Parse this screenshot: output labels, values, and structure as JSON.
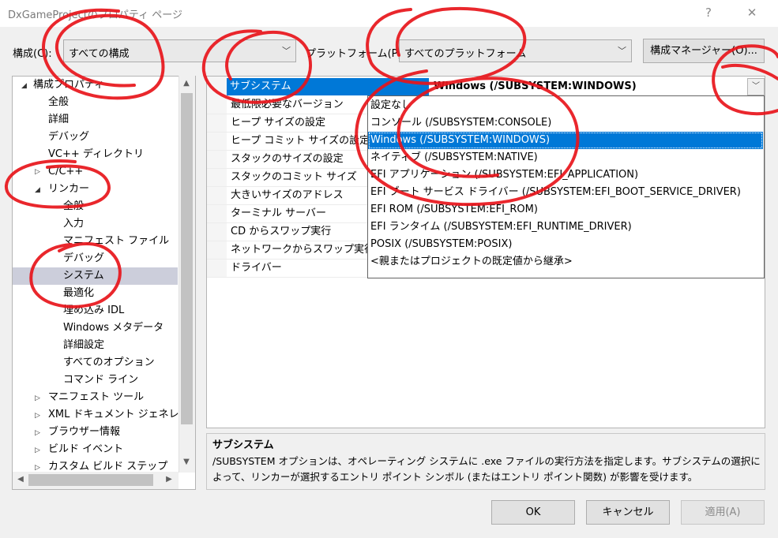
{
  "window": {
    "title": "DxGameProjectのプロパティ ページ",
    "help_glyph": "?",
    "close_glyph": "✕"
  },
  "toolbar": {
    "config_label": "構成(C):",
    "config_value": "すべての構成",
    "platform_label": "プラットフォーム(P):",
    "platform_value": "すべてのプラットフォーム",
    "config_manager_label": "構成マネージャー(O)..."
  },
  "tree": {
    "items": [
      {
        "label": "構成プロパティ",
        "expander": "◢"
      },
      {
        "label": "全般"
      },
      {
        "label": "詳細"
      },
      {
        "label": "デバッグ"
      },
      {
        "label": "VC++ ディレクトリ"
      },
      {
        "label": "C/C++",
        "expander": "▷"
      },
      {
        "label": "リンカー",
        "expander": "◢"
      },
      {
        "label": "全般"
      },
      {
        "label": "入力"
      },
      {
        "label": "マニフェスト ファイル"
      },
      {
        "label": "デバッグ"
      },
      {
        "label": "システム"
      },
      {
        "label": "最適化"
      },
      {
        "label": "埋め込み IDL"
      },
      {
        "label": "Windows メタデータ"
      },
      {
        "label": "詳細設定"
      },
      {
        "label": "すべてのオプション"
      },
      {
        "label": "コマンド ライン"
      },
      {
        "label": "マニフェスト ツール",
        "expander": "▷"
      },
      {
        "label": "XML ドキュメント ジェネレーター",
        "expander": "▷"
      },
      {
        "label": "ブラウザー情報",
        "expander": "▷"
      },
      {
        "label": "ビルド イベント",
        "expander": "▷"
      },
      {
        "label": "カスタム ビルド ステップ",
        "expander": "▷"
      }
    ]
  },
  "grid": {
    "rows": [
      {
        "name": "サブシステム"
      },
      {
        "name": "最低限必要なバージョン"
      },
      {
        "name": "ヒープ サイズの設定"
      },
      {
        "name": "ヒープ コミット サイズの設定"
      },
      {
        "name": "スタックのサイズの設定"
      },
      {
        "name": "スタックのコミット サイズ"
      },
      {
        "name": "大きいサイズのアドレス"
      },
      {
        "name": "ターミナル サーバー"
      },
      {
        "name": "CD からスワップ実行"
      },
      {
        "name": "ネットワークからスワップ実行"
      },
      {
        "name": "ドライバー"
      }
    ],
    "selected_value": "Windows (/SUBSYSTEM:WINDOWS)",
    "dropdown_arrow": "﹀"
  },
  "dropdown": {
    "options": [
      "設定なし",
      "コンソール (/SUBSYSTEM:CONSOLE)",
      "Windows (/SUBSYSTEM:WINDOWS)",
      "ネイティブ (/SUBSYSTEM:NATIVE)",
      "EFI アプリケーション (/SUBSYSTEM:EFI_APPLICATION)",
      "EFI ブート サービス ドライバー (/SUBSYSTEM:EFI_BOOT_SERVICE_DRIVER)",
      "EFI ROM (/SUBSYSTEM:EFI_ROM)",
      "EFI ランタイム (/SUBSYSTEM:EFI_RUNTIME_DRIVER)",
      "POSIX (/SUBSYSTEM:POSIX)",
      "<親またはプロジェクトの既定値から継承>"
    ]
  },
  "description": {
    "title": "サブシステム",
    "text": "/SUBSYSTEM オプションは、オペレーティング システムに .exe ファイルの実行方法を指定します。サブシステムの選択によって、リンカーが選択するエントリ ポイント シンボル (またはエントリ ポイント関数) が影響を受けます。"
  },
  "buttons": {
    "ok": "OK",
    "cancel": "キャンセル",
    "apply": "適用(A)"
  },
  "colors": {
    "selection": "#0078d7",
    "tree_selection": "#cccedb",
    "annotation": "#e8151b"
  }
}
